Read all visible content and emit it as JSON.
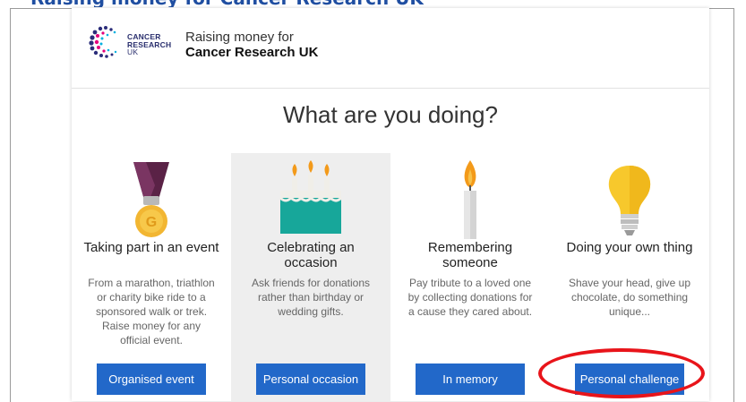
{
  "top_strip": {
    "text": "Raising money for Cancer Research UK"
  },
  "logo": {
    "text_lines": [
      "CANCER",
      "RESEARCH",
      "UK"
    ],
    "icon": "cancer-research-uk-logo-icon"
  },
  "header": {
    "raising_label": "Raising money for",
    "organisation": "Cancer Research UK"
  },
  "question": "What are you doing?",
  "cards": [
    {
      "title": "Taking part in an event",
      "description": "From a marathon, triathlon or charity bike ride to a sponsored walk or trek. Raise money for any official event.",
      "button": "Organised event",
      "icon": "medal-icon",
      "selected": false
    },
    {
      "title": "Celebrating an occasion",
      "description": "Ask friends for donations rather than birthday or wedding gifts.",
      "button": "Personal occasion",
      "icon": "birthday-cake-icon",
      "selected": true
    },
    {
      "title": "Remembering someone",
      "description": "Pay tribute to a loved one by collecting donations for a cause they cared about.",
      "button": "In memory",
      "icon": "candle-icon",
      "selected": false
    },
    {
      "title": "Doing your own thing",
      "description": "Shave your head, give up chocolate, do something unique...",
      "button": "Personal challenge",
      "icon": "light-bulb-icon",
      "selected": false
    }
  ],
  "colors": {
    "button": "#2268c9",
    "selected_card_bg": "#eeeeee",
    "highlight_annotation": "#e8141a",
    "brand_text": "#2a2f6e"
  }
}
